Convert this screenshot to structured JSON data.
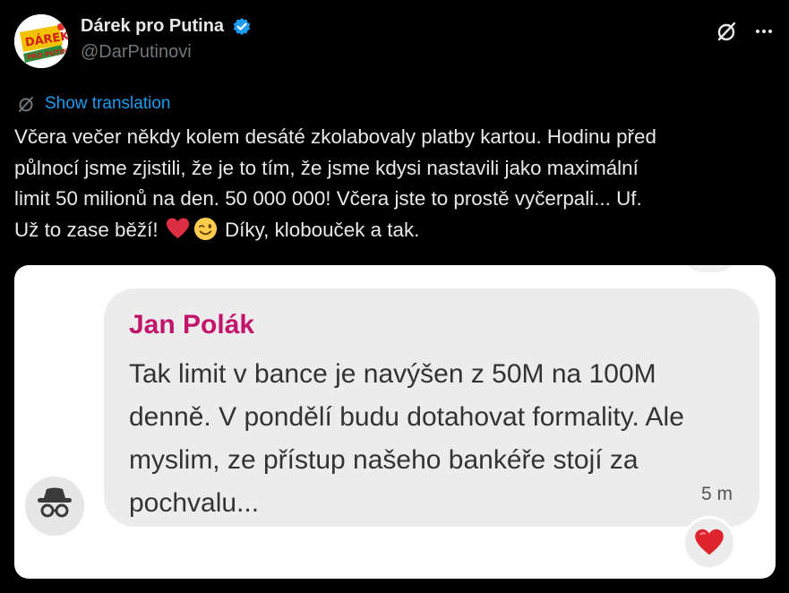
{
  "header": {
    "display_name": "Dárek pro Putina",
    "handle": "@DarPutinovi",
    "avatar_text_top": "DÁREK",
    "avatar_text_bottom": "PRO PUTINA",
    "icons": [
      "verified-badge-icon",
      "grok-icon",
      "more-icon"
    ]
  },
  "translation": {
    "label": "Show translation"
  },
  "tweet": {
    "line1": "Včera večer někdy kolem desáté zkolabovaly platby kartou. Hodinu před",
    "line2": "půlnocí jsme zjistili, že je to tím, že jsme kdysi nastavili jako maximální",
    "line3": "limit 50 milionů na den. 50 000 000! Včera jste to prostě vyčerpali... Uf.",
    "line4_a": "Už to zase běží!",
    "line4_b": "Díky, klobouček a tak."
  },
  "media": {
    "sender": "Jan Polák",
    "message": "Tak limit v bance je navýšen z 50M na 100M denně. V pondělí budu dotahovat formality. Ale myslim, ze přístup našeho bankéře stojí za pochvalu...",
    "time": "5 m",
    "reaction": "heart-emoji"
  },
  "colors": {
    "background": "#000000",
    "text": "#e7e9ea",
    "secondary": "#71767b",
    "link": "#1d9bf0",
    "sender": "#c2146b",
    "verified": "#1d9bf0"
  }
}
